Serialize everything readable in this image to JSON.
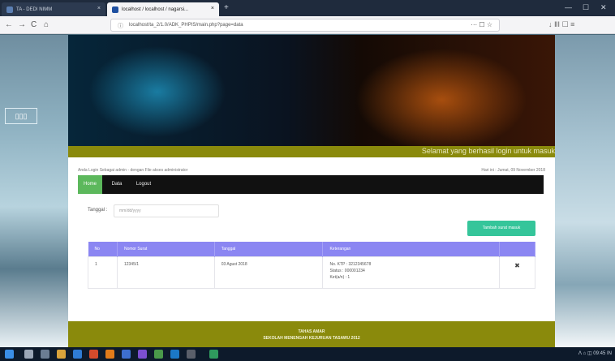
{
  "browser": {
    "tab_inactive_title": "TA - DEDI NIMM",
    "tab_active_title": "localhost / localhost / nagarsi...",
    "new_tab": "+",
    "close_glyph": "×",
    "url": "localhost/ta_2/1.0/ADK_PHPIS/main.php?page=data",
    "nav_back": "←",
    "nav_forward": "→",
    "nav_reload": "C",
    "nav_home": "⌂",
    "url_right": "··· ☐ ☆",
    "right_tools": "↓ ⅡⅠ ☐ ≡",
    "win_min": "—",
    "win_max": "☐",
    "win_close": "✕"
  },
  "desktop": {
    "left_box_glyph": "▯▯▯"
  },
  "page": {
    "marquee_text": "Selamat yang berhasil login untuk masuk",
    "info_left": "Anda Login Sebagai admin - dengan File akses administrator",
    "info_right": "Hari ini : Jumat, 09 November 2018",
    "menu": {
      "home": "Home",
      "data": "Data",
      "logout": "Logout"
    },
    "date_filter": {
      "label": "Tanggal :",
      "placeholder": "mm/dd/yyyy"
    },
    "add_button": "Tambah surat masuk",
    "table": {
      "headers": [
        "No",
        "Nomor Surat",
        "Tanggal",
        "Keterangan",
        ""
      ],
      "rows": [
        {
          "no": "1",
          "nomor": "12345/1",
          "tanggal": "03 Agust 2018",
          "keterangan": [
            "No. KTP : 3212345678",
            "Status : 000001234",
            "Ket(a/n) : 1"
          ],
          "action": "✖"
        }
      ]
    },
    "footer": {
      "line1": "TAHAS AMAR",
      "line2": "SEKOLAH MENENGAH KEJURUAN TASAWU 2012"
    }
  },
  "taskbar": {
    "tray": "ᐱ ⌂ ◫ 09:45 IN"
  },
  "colors": {
    "accent_green": "#5cb85c",
    "olive": "#8a8a0c",
    "table_header": "#8b86f2",
    "button_teal": "#35c59a"
  }
}
